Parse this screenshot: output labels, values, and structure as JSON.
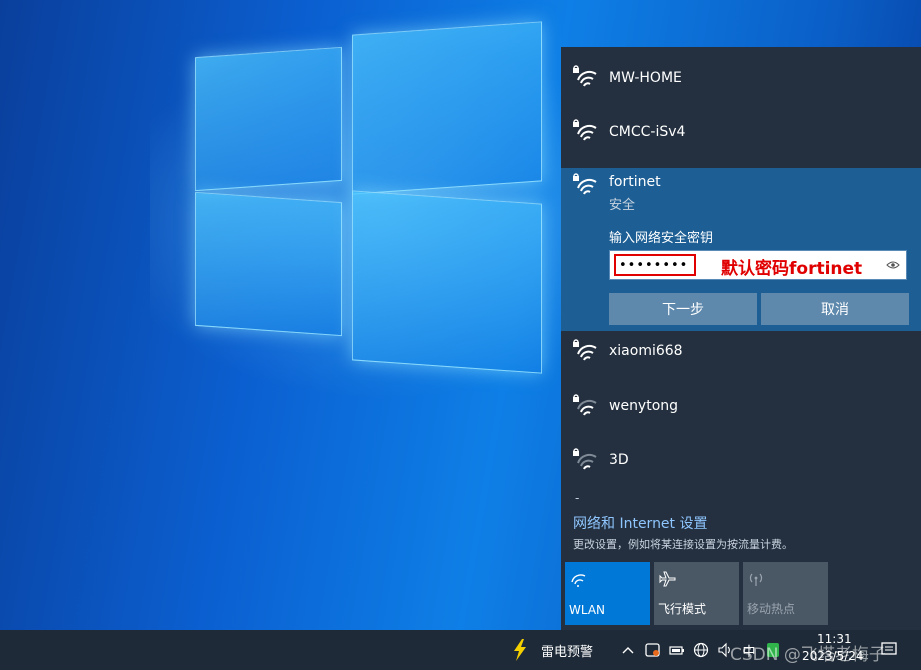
{
  "networks": [
    {
      "name": "MW-HOME"
    },
    {
      "name": "CMCC-iSv4"
    },
    {
      "name": "fortinet",
      "status": "安全",
      "expanded": true
    },
    {
      "name": "xiaomi668"
    },
    {
      "name": "wenytong"
    },
    {
      "name": "3D"
    }
  ],
  "connect_panel": {
    "key_label": "输入网络安全密钥",
    "key_value": "••••••••",
    "annotation": "默认密码fortinet",
    "next_label": "下一步",
    "cancel_label": "取消"
  },
  "footer": {
    "dash": "-",
    "settings_link": "网络和 Internet 设置",
    "settings_desc": "更改设置，例如将某连接设置为按流量计费。"
  },
  "quick_actions": [
    {
      "label": "WLAN",
      "icon": "wifi-icon",
      "active": true
    },
    {
      "label": "飞行模式",
      "icon": "airplane-icon",
      "active": false
    },
    {
      "label": "移动热点",
      "icon": "hotspot-icon",
      "active": false,
      "disabled": true
    }
  ],
  "taskbar": {
    "weather_text": "雷电预警",
    "tray_chevron": "^",
    "ime_label": "中",
    "time": "11:31",
    "date": "2023/5/24",
    "watermark": "CSDN @飞塔老梅子"
  },
  "colors": {
    "flyout_bg": "#24303f",
    "expanded_bg": "#1d5f95",
    "accent_tile": "#0078d7",
    "annotation_red": "#e00000"
  }
}
